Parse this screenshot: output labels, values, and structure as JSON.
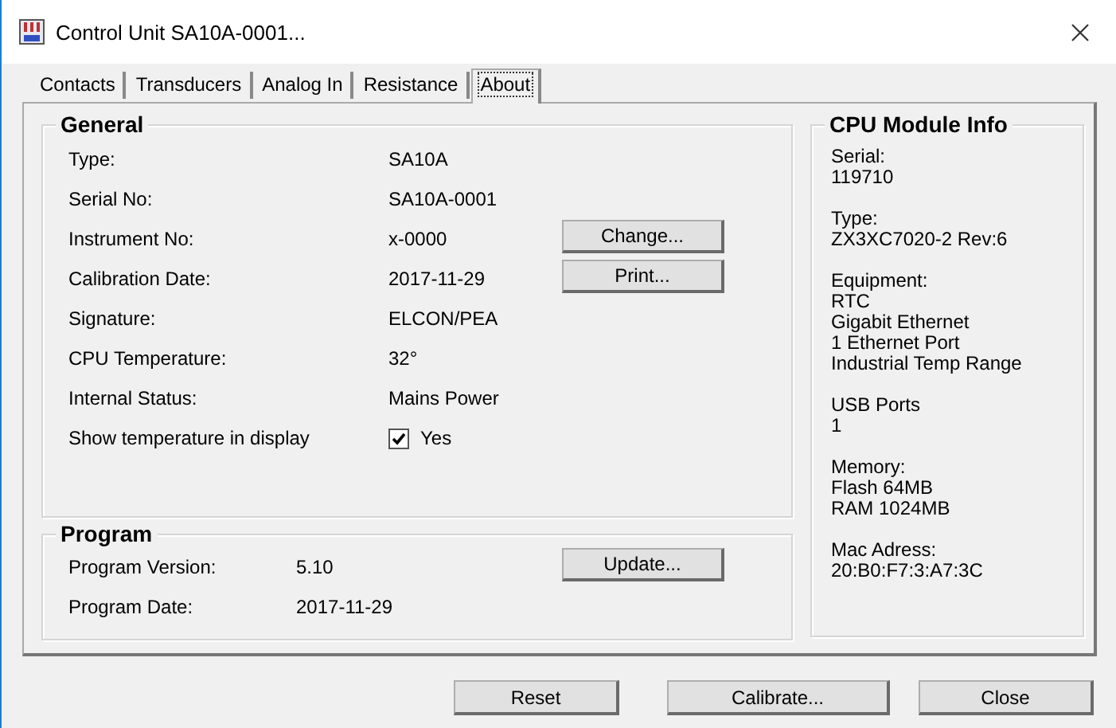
{
  "window": {
    "title": "Control Unit SA10A-0001..."
  },
  "tabs": [
    {
      "label": "Contacts",
      "selected": false
    },
    {
      "label": "Transducers",
      "selected": false
    },
    {
      "label": "Analog In",
      "selected": false
    },
    {
      "label": "Resistance",
      "selected": false
    },
    {
      "label": "About",
      "selected": true
    }
  ],
  "general": {
    "title": "General",
    "fields": [
      {
        "label": "Type:",
        "value": "SA10A"
      },
      {
        "label": "Serial No:",
        "value": "SA10A-0001"
      },
      {
        "label": "Instrument No:",
        "value": "x-0000",
        "button": "Change..."
      },
      {
        "label": "Calibration Date:",
        "value": "2017-11-29",
        "button": "Print..."
      },
      {
        "label": "Signature:",
        "value": "ELCON/PEA"
      },
      {
        "label": "CPU Temperature:",
        "value": "32°"
      },
      {
        "label": "Internal Status:",
        "value": "Mains Power"
      }
    ],
    "show_temperature": {
      "label": "Show temperature in display",
      "option": "Yes",
      "checked": true
    }
  },
  "program": {
    "title": "Program",
    "fields": [
      {
        "label": "Program Version:",
        "value": "5.10"
      },
      {
        "label": "Program Date:",
        "value": "2017-11-29"
      }
    ],
    "button": "Update..."
  },
  "cpu_module": {
    "title": "CPU Module Info",
    "sections": [
      {
        "heading": "Serial:",
        "lines": [
          "119710"
        ]
      },
      {
        "heading": "Type:",
        "lines": [
          "ZX3XC7020-2 Rev:6"
        ]
      },
      {
        "heading": "Equipment:",
        "lines": [
          "RTC",
          "Gigabit Ethernet",
          "1 Ethernet Port",
          "Industrial Temp Range"
        ]
      },
      {
        "heading": "USB Ports",
        "lines": [
          "1"
        ]
      },
      {
        "heading": "Memory:",
        "lines": [
          "Flash 64MB",
          "RAM 1024MB"
        ]
      },
      {
        "heading": "Mac Adress:",
        "lines": [
          "20:B0:F7:3:A7:3C"
        ]
      }
    ]
  },
  "footer_buttons": [
    "Reset",
    "Calibrate...",
    "Close"
  ]
}
